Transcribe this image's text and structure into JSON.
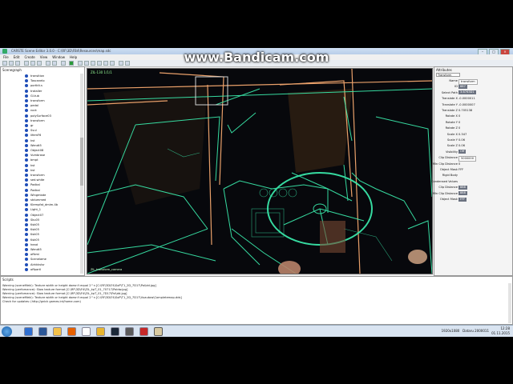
{
  "watermark": "www.Bandicam.com",
  "window": {
    "title": "CARSTE Scene Editor 3.0.0 - C:\\RF\\3D\\FB4\\Resources\\map.sdc",
    "menus": [
      "File",
      "Edit",
      "Create",
      "View",
      "Window",
      "Help"
    ]
  },
  "scenegraph": {
    "title": "Scenegraph",
    "items": [
      "transition",
      "Toscanelo",
      "portkit.s",
      "trataller",
      "Gl.tub",
      "transform",
      "pedal",
      "rock",
      "polySurface03",
      "transform",
      "gr",
      "Svul",
      "lifemF6",
      "kst",
      "Wendt5",
      "Object08",
      "Vumbrase",
      "bmpt",
      "kst",
      "kst",
      "transform",
      "sed.white",
      "Padkal",
      "Padkal",
      "Wingmbde",
      "stdummed",
      "Klempfat_dmim.4b",
      "Light_1",
      "Object07",
      "Sku05",
      "Ksk05",
      "Ksk05",
      "Ksk05",
      "Ksk05",
      "head",
      "Wendt5",
      "offzmi",
      "Scenelame",
      "Airkkkvlsr",
      "offpartl"
    ]
  },
  "viewport": {
    "label": "ZIL-130 1/1/1",
    "caption": "ZIL_transform_camera"
  },
  "properties": {
    "title": "Attributes",
    "tab": "Transform",
    "rows": [
      {
        "label": "Name",
        "value": "transform",
        "style": "input"
      },
      {
        "label": "ID",
        "value": "687",
        "style": "box"
      },
      {
        "label": "Select Path",
        "value": "3:8763D1",
        "style": "box"
      },
      {
        "label": "Translate X",
        "value": "-0.0000011",
        "style": "plain"
      },
      {
        "label": "Translate Y",
        "value": "-0.0000007",
        "style": "plain"
      },
      {
        "label": "Translate Z",
        "value": "0.705138",
        "style": "plain"
      },
      {
        "label": "Rotate X",
        "value": "0",
        "style": "plain"
      },
      {
        "label": "Rotate Y",
        "value": "0",
        "style": "plain"
      },
      {
        "label": "Rotate Z",
        "value": "0",
        "style": "plain"
      },
      {
        "label": "Scale X",
        "value": "0.347",
        "style": "plain"
      },
      {
        "label": "Scale Y",
        "value": "0.06",
        "style": "plain"
      },
      {
        "label": "Scale Z",
        "value": "0.06",
        "style": "plain"
      },
      {
        "label": "Visibility",
        "value": "Off",
        "style": "box"
      },
      {
        "label": "Clip Distance",
        "value": "5000000",
        "style": "input"
      },
      {
        "label": "Min Clip Distance",
        "value": "0",
        "style": "plain"
      },
      {
        "label": "Object Mask",
        "value": "FFF",
        "style": "plain"
      },
      {
        "label": "Rigid Body",
        "value": "",
        "style": "plain"
      },
      {
        "label": "Condensed Values",
        "value": "",
        "style": "plain"
      },
      {
        "label": "Clip Distance",
        "value": "888",
        "style": "box"
      },
      {
        "label": "Min Clip Distance",
        "value": "888",
        "style": "box"
      },
      {
        "label": "Object Mask",
        "value": "FFF",
        "style": "box"
      }
    ]
  },
  "scripts": {
    "title": "Scripts",
    "lines": [
      "Warning (sceneMeki): Texture width or height doesn't equal 2^n [C:\\RF\\3D\\F4\\SoP\\T1_2D_7D17\\Pol\\dd.jpg]",
      "Warning (perfomance): Slow texture format [C:\\RF\\3D\\F4\\ZIL_kpT_01_70717\\Poldw.jpg]",
      "Warning (perfomance): Slow texture format [C:\\RF\\3D\\F4\\ZIL_kpT_01_7D17\\Pol\\dd.jpg]",
      "Warning (sceneMeki): Texture width or height doesn't equal 2^n [C:\\RF\\3D\\F4\\SoP\\T1_2D_7D17\\Vuautow\\Completemap.dds]",
      "Check for updates: (http://gnick games.int/home.com)"
    ]
  },
  "taskbar": {
    "tray_text": "1920x1080",
    "tray_label": "Dataru 2000011",
    "time": "12:28",
    "date": "01.11.2015"
  }
}
